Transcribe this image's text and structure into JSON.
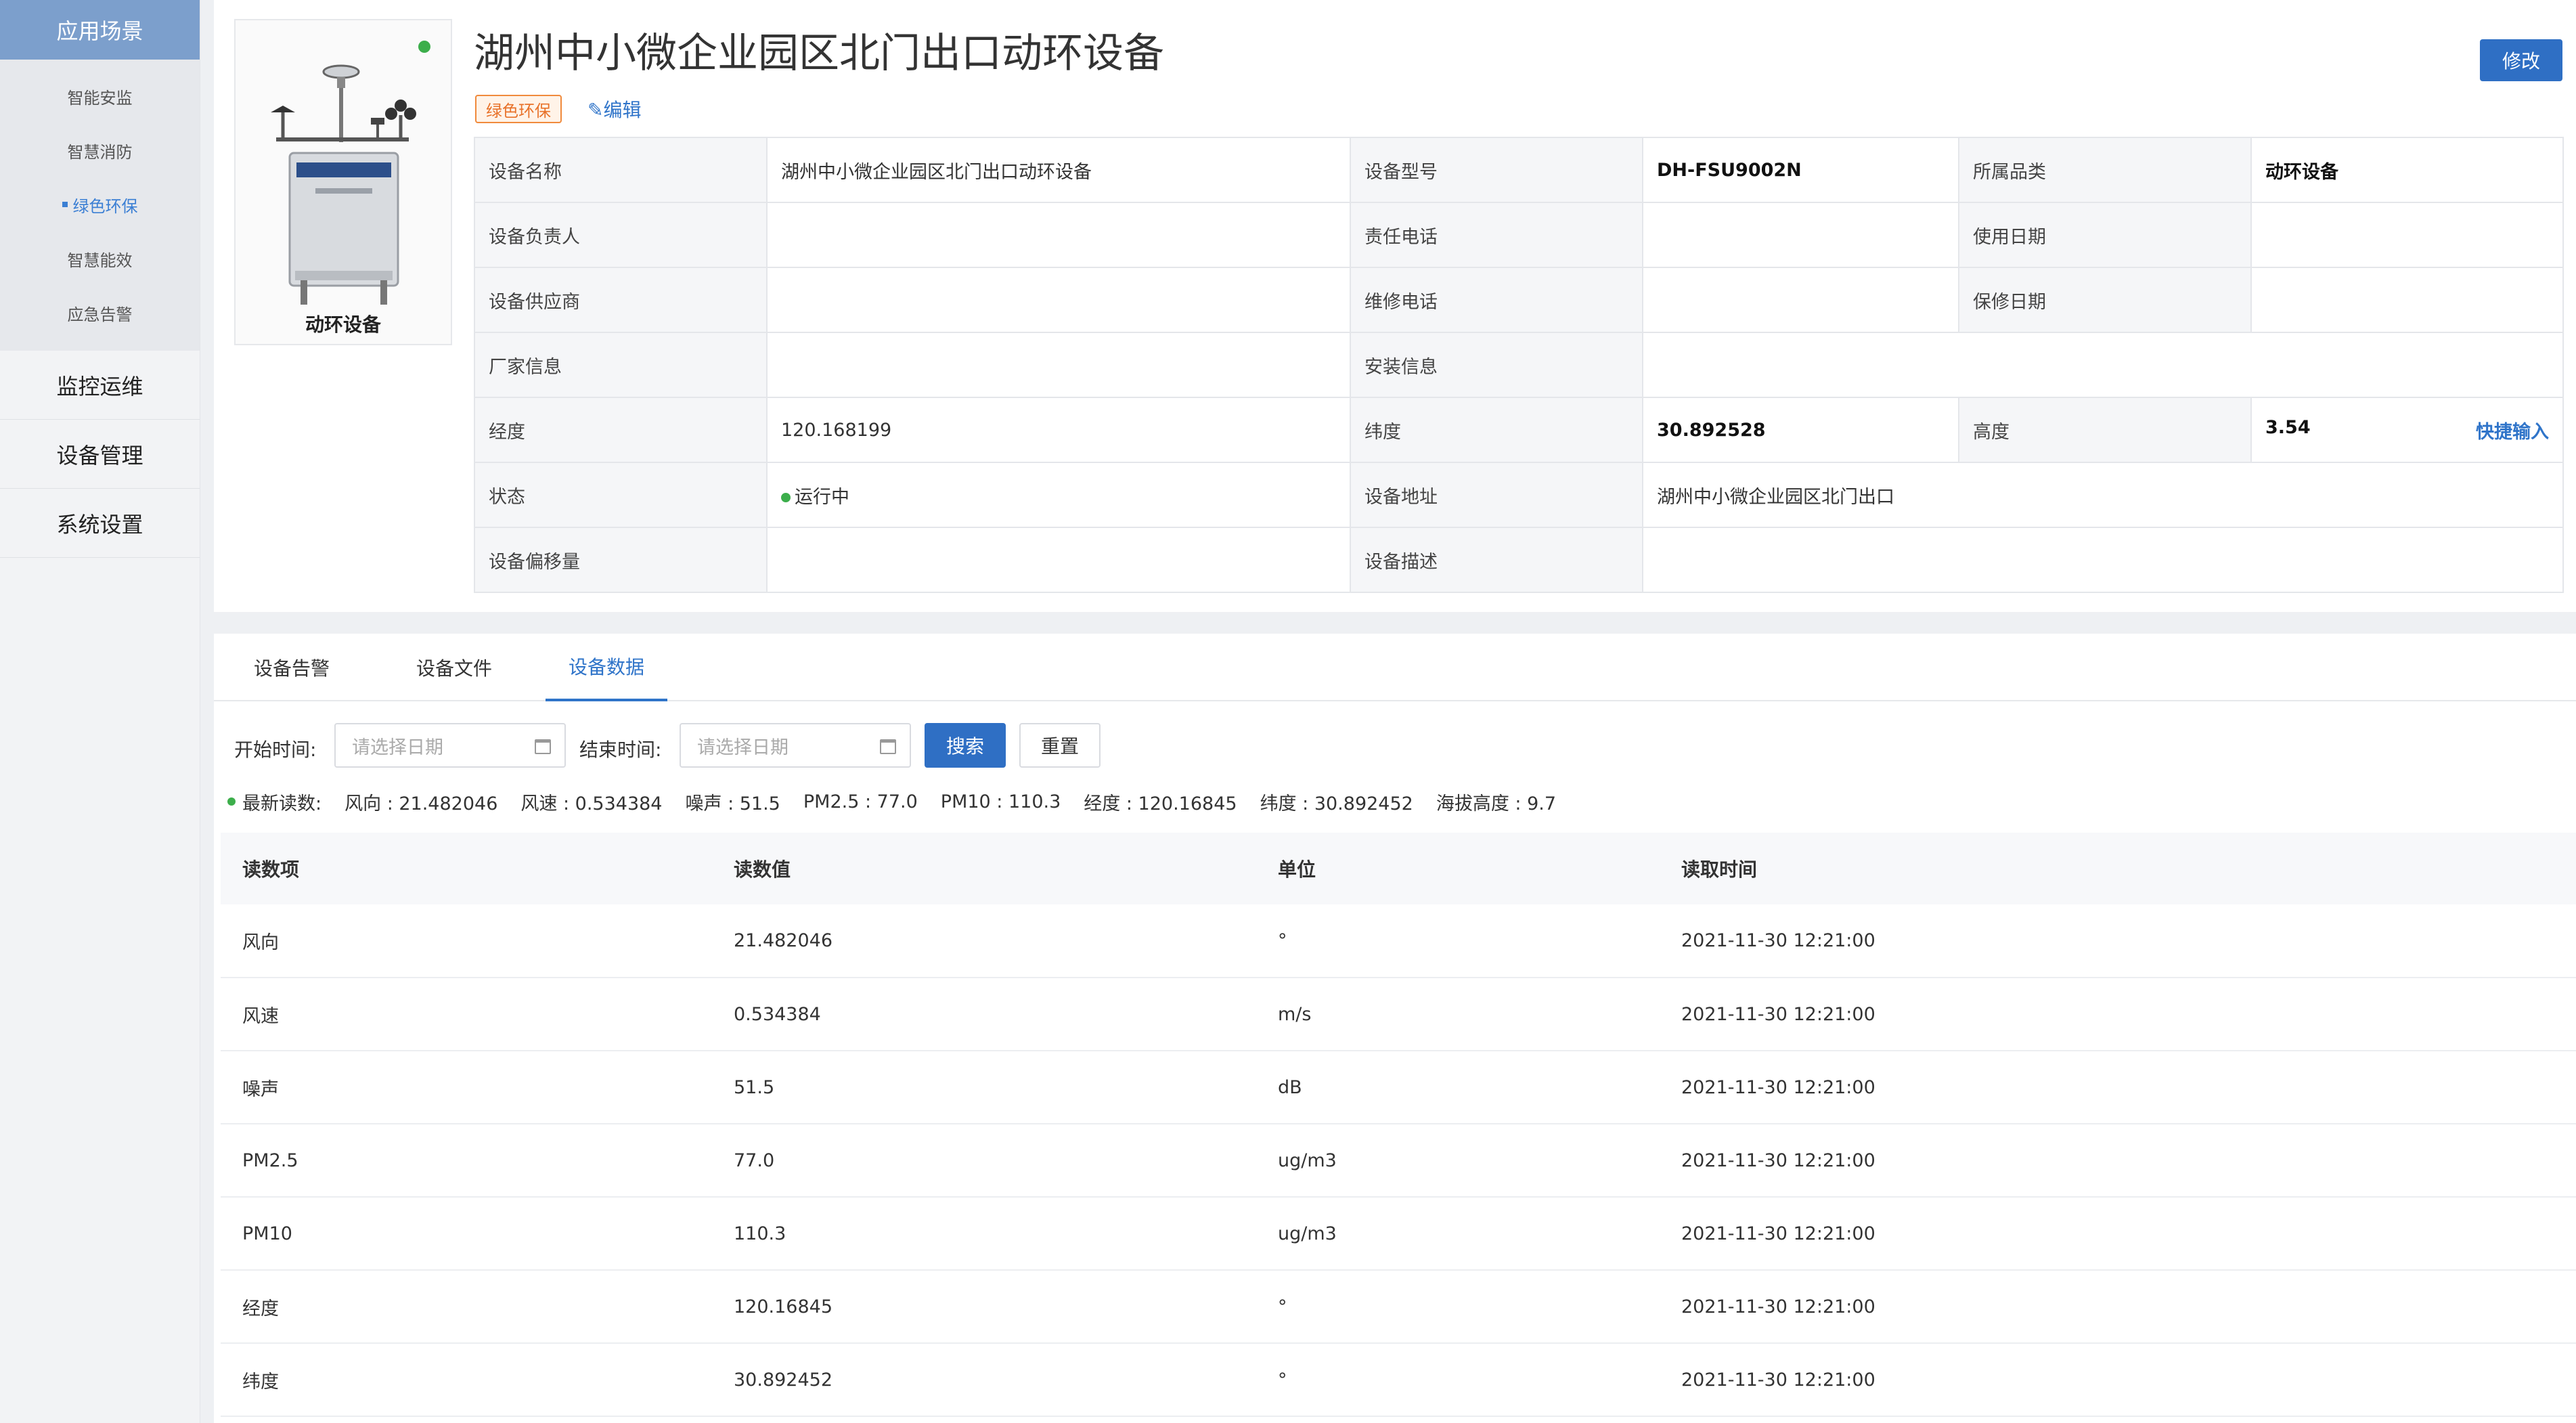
{
  "sidebar": {
    "header": "应用场景",
    "sub_items": [
      {
        "label": "智能安监"
      },
      {
        "label": "智慧消防"
      },
      {
        "label": "绿色环保"
      },
      {
        "label": "智慧能效"
      },
      {
        "label": "应急告警"
      }
    ],
    "main_items": [
      {
        "label": "监控运维"
      },
      {
        "label": "设备管理"
      },
      {
        "label": "系统设置"
      }
    ]
  },
  "device": {
    "title": "湖州中小微企业园区北门出口动环设备",
    "tag": "绿色环保",
    "edit_label": "✎编辑",
    "modify_label": "修改",
    "card_label": "动环设备"
  },
  "info": {
    "name_label": "设备名称",
    "name": "湖州中小微企业园区北门出口动环设备",
    "model_label": "设备型号",
    "model": "DH-FSU9002N",
    "category_label": "所属品类",
    "category": "动环设备",
    "owner_label": "设备负责人",
    "owner": "",
    "phone_label": "责任电话",
    "phone": "",
    "use_date_label": "使用日期",
    "use_date": "",
    "supplier_label": "设备供应商",
    "supplier": "",
    "repair_phone_label": "维修电话",
    "repair_phone": "",
    "warranty_label": "保修日期",
    "warranty": "",
    "vendor_label": "厂家信息",
    "vendor": "",
    "install_label": "安装信息",
    "install": "",
    "lng_label": "经度",
    "lng": "120.168199",
    "lat_label": "纬度",
    "lat": "30.892528",
    "height_label": "高度",
    "height": "3.54",
    "quick_input": "快捷输入",
    "status_label": "状态",
    "status": "运行中",
    "address_label": "设备地址",
    "address": "湖州中小微企业园区北门出口",
    "offset_label": "设备偏移量",
    "offset": "",
    "desc_label": "设备描述",
    "desc": ""
  },
  "tabs": [
    {
      "label": "设备告警"
    },
    {
      "label": "设备文件"
    },
    {
      "label": "设备数据"
    }
  ],
  "filter": {
    "start_label": "开始时间:",
    "end_label": "结束时间:",
    "placeholder": "请选择日期",
    "search": "搜索",
    "reset": "重置"
  },
  "latest": {
    "label": "最新读数:",
    "values": [
      "风向 : 21.482046",
      "风速 : 0.534384",
      "噪声 : 51.5",
      "PM2.5 : 77.0",
      "PM10 : 110.3",
      "经度 : 120.16845",
      "纬度 : 30.892452",
      "海拔高度 : 9.7"
    ]
  },
  "table": {
    "headers": [
      "读数项",
      "读数值",
      "单位",
      "读取时间"
    ],
    "rows": [
      [
        "风向",
        "21.482046",
        "°",
        "2021-11-30 12:21:00"
      ],
      [
        "风速",
        "0.534384",
        "m/s",
        "2021-11-30 12:21:00"
      ],
      [
        "噪声",
        "51.5",
        "dB",
        "2021-11-30 12:21:00"
      ],
      [
        "PM2.5",
        "77.0",
        "ug/m3",
        "2021-11-30 12:21:00"
      ],
      [
        "PM10",
        "110.3",
        "ug/m3",
        "2021-11-30 12:21:00"
      ],
      [
        "经度",
        "120.16845",
        "°",
        "2021-11-30 12:21:00"
      ],
      [
        "纬度",
        "30.892452",
        "°",
        "2021-11-30 12:21:00"
      ]
    ]
  }
}
